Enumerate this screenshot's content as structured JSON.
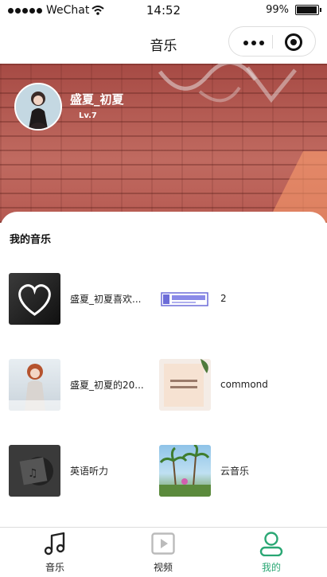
{
  "status_bar": {
    "carrier": "WeChat",
    "time": "14:52",
    "battery": "99%",
    "battery_level": 0.99
  },
  "nav": {
    "title": "音乐"
  },
  "profile": {
    "name": "盛夏_初夏",
    "level": "Lv.7"
  },
  "my_music": {
    "title": "我的音乐",
    "playlists": [
      {
        "name": "盛夏_初夏喜欢...",
        "cover": "heart-cover"
      },
      {
        "name": "2",
        "cover": "study-banner-cover"
      },
      {
        "name": "盛夏_初夏的20...",
        "cover": "portrait-cover"
      },
      {
        "name": "commond",
        "cover": "book-cover"
      },
      {
        "name": "英语听力",
        "cover": "vinyl-cover"
      },
      {
        "name": "云音乐",
        "cover": "palm-trees-cover"
      }
    ]
  },
  "tabs": [
    {
      "label": "音乐",
      "icon": "music-note-icon",
      "active": false
    },
    {
      "label": "视频",
      "icon": "video-play-icon",
      "active": false
    },
    {
      "label": "我的",
      "icon": "user-icon",
      "active": true
    }
  ],
  "colors": {
    "accent": "#2aa774",
    "banner": "#b85a52"
  }
}
